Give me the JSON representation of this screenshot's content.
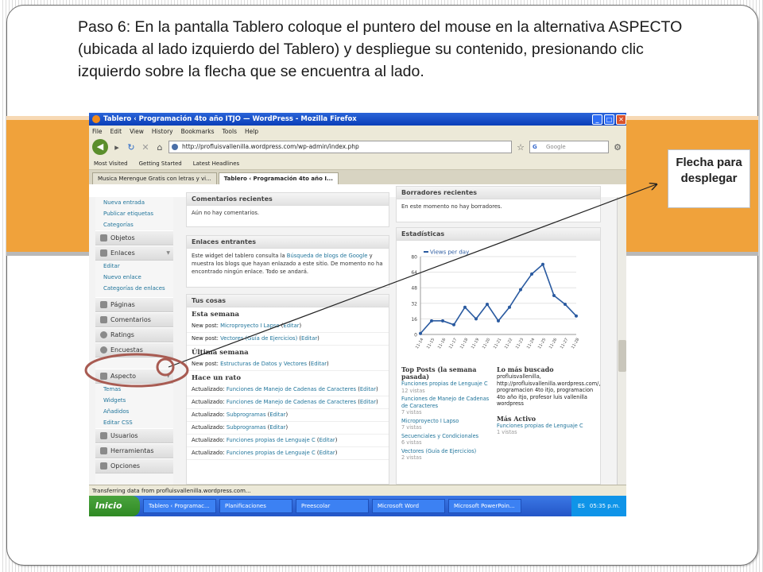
{
  "caption": "Paso 6: En la pantalla Tablero coloque el puntero del mouse en la alternativa ASPECTO (ubicada al lado izquierdo del Tablero) y despliegue su contenido, presionando clic izquierdo sobre la flecha que se encuentra al lado.",
  "callout": "Flecha para desplegar",
  "browser": {
    "window_title": "Tablero ‹ Programación 4to año ITJO — WordPress - Mozilla Firefox",
    "menu": [
      "File",
      "Edit",
      "View",
      "History",
      "Bookmarks",
      "Tools",
      "Help"
    ],
    "url": "http://profluisvallenilla.wordpress.com/wp-admin/index.php",
    "search_placeholder": "Google",
    "bookmarks": [
      "Most Visited",
      "Getting Started",
      "Latest Headlines"
    ],
    "tabs": [
      "Musica Merengue Gratis con letras y vi...",
      "Tablero ‹ Programación 4to año I..."
    ],
    "status": "Transferring data from profluisvallenilla.wordpress.com..."
  },
  "sidebar": {
    "entradas_sub": [
      "Nueva entrada",
      "Publicar etiquetas",
      "Categorías"
    ],
    "objetos": "Objetos",
    "enlaces": "Enlaces",
    "enlaces_sub": [
      "Editar",
      "Nuevo enlace",
      "Categorías de enlaces"
    ],
    "menu": [
      "Páginas",
      "Comentarios",
      "Ratings",
      "Encuestas"
    ],
    "aspecto": "Aspecto",
    "aspecto_sub": [
      "Temas",
      "Widgets",
      "Añadidos",
      "Editar CSS"
    ],
    "bottom": [
      "Usuarios",
      "Herramientas",
      "Opciones"
    ]
  },
  "widgets": {
    "comentarios": {
      "title": "Comentarios recientes",
      "text": "Aún no hay comentarios."
    },
    "enlaces": {
      "title": "Enlaces entrantes",
      "text1": "Este widget del tablero consulta la ",
      "link1": "Búsqueda de blogs de Google",
      "text2": " y muestra los blogs que hayan enlazado a este sitio. De momento no ha encontrado ningún enlace. Todo se andará."
    },
    "tus_cosas": {
      "title": "Tus cosas",
      "esta_semana": "Esta semana",
      "ultima_semana": "Última semana",
      "hace_un_rato": "Hace un rato",
      "rows_esta": [
        {
          "pre": "New post: ",
          "link": "Microproyecto I Lapso",
          "edit": "Editar"
        },
        {
          "pre": "New post: ",
          "link": "Vectores (Guía de Ejercicios)",
          "edit": "Editar"
        }
      ],
      "rows_ultima": [
        {
          "pre": "New post: ",
          "link": "Estructuras de Datos y Vectores",
          "edit": "Editar"
        }
      ],
      "rows_rato": [
        {
          "pre": "Actualizado: ",
          "link": "Funciones de Manejo de Cadenas de Caracteres",
          "edit": "Editar"
        },
        {
          "pre": "Actualizado: ",
          "link": "Funciones de Manejo de Cadenas de Caracteres",
          "edit": "Editar"
        },
        {
          "pre": "Actualizado: ",
          "link": "Subprogramas",
          "edit": "Editar"
        },
        {
          "pre": "Actualizado: ",
          "link": "Subprogramas",
          "edit": "Editar"
        },
        {
          "pre": "Actualizado: ",
          "link": "Funciones propias de Lenguaje C",
          "edit": "Editar"
        },
        {
          "pre": "Actualizado: ",
          "link": "Funciones propias de Lenguaje C",
          "edit": "Editar"
        }
      ]
    },
    "borradores": {
      "title": "Borradores recientes",
      "text": "En este momento no hay borradores."
    },
    "estadisticas": {
      "title": "Estadísticas"
    },
    "top_posts": {
      "title": "Top Posts (la semana pasada)",
      "items": [
        {
          "name": "Funciones propias de Lenguaje C",
          "views": "12 vistas"
        },
        {
          "name": "Funciones de Manejo de Cadenas de Caracteres",
          "views": "7 vistas"
        },
        {
          "name": "Microproyecto I Lapso",
          "views": "7 vistas"
        },
        {
          "name": "Secuenciales y Condicionales",
          "views": "6 vistas"
        },
        {
          "name": "Vectores (Guía de Ejercicios)",
          "views": "2 vistas"
        }
      ]
    },
    "lo_mas_buscado": {
      "title": "Lo más buscado",
      "text": "profluisvallenilla, http://profluisvallenilla.wordpress.com/, programacion 4to itjo, programacion 4to año itjo, profesor luis vallenilla wordpress"
    },
    "mas_activo": {
      "title": "Más Activo",
      "item": "Funciones propias de Lenguaje C",
      "views": "1 vistas"
    }
  },
  "chart_data": {
    "type": "line",
    "title": "",
    "legend": "Views per day",
    "x": [
      "11-14",
      "11-15",
      "11-16",
      "11-17",
      "11-18",
      "11-19",
      "11-20",
      "11-21",
      "11-22",
      "11-23",
      "11-24",
      "11-25",
      "11-26",
      "11-27",
      "11-28"
    ],
    "values": [
      1,
      14,
      14,
      10,
      28,
      16,
      31,
      14,
      28,
      46,
      62,
      72,
      40,
      31,
      19
    ],
    "yticks": [
      0,
      16,
      32,
      48,
      64,
      80
    ],
    "ylim": [
      0,
      80
    ],
    "color": "#2a5aa0",
    "grid": true
  },
  "taskbar": {
    "start": "Inicio",
    "items": [
      "Tablero ‹ Programac...",
      "Planificaciones",
      "Preescolar",
      "Microsoft Word",
      "Microsoft PowerPoin..."
    ],
    "lang": "ES",
    "time": "05:35 p.m."
  },
  "colors": {
    "accent": "#f0a23b",
    "link": "#21759b",
    "highlight": "#a85b52"
  }
}
